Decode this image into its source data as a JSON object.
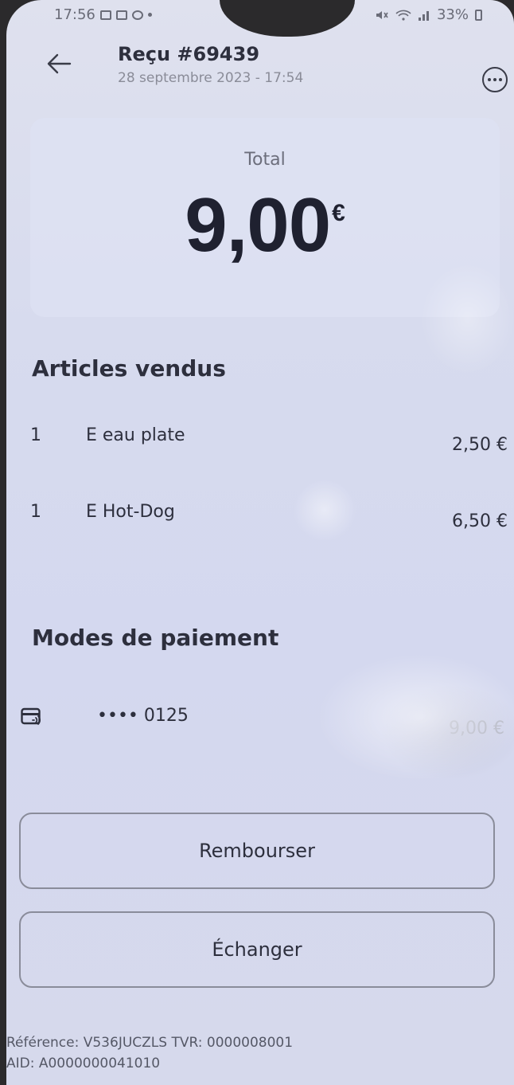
{
  "status_bar": {
    "time": "17:56",
    "battery": "33%"
  },
  "header": {
    "title": "Reçu #69439",
    "date": "28 septembre 2023 - 17:54"
  },
  "total": {
    "label": "Total",
    "amount": "9,00",
    "currency": "€"
  },
  "items_section": {
    "title": "Articles vendus",
    "items": [
      {
        "qty": "1",
        "name": "E eau plate",
        "price": "2,50 €"
      },
      {
        "qty": "1",
        "name": "E Hot-Dog",
        "price": "6,50 €"
      }
    ]
  },
  "payment_section": {
    "title": "Modes de paiement",
    "card_icon": "contactless-card-icon",
    "card_number": "•••• 0125",
    "amount": "9,00 €"
  },
  "actions": {
    "refund_label": "Rembourser",
    "exchange_label": "Échanger"
  },
  "footer": {
    "line1": "Référence: V536JUCZLS TVR: 0000008001",
    "line2": "AID: A0000000041010"
  }
}
